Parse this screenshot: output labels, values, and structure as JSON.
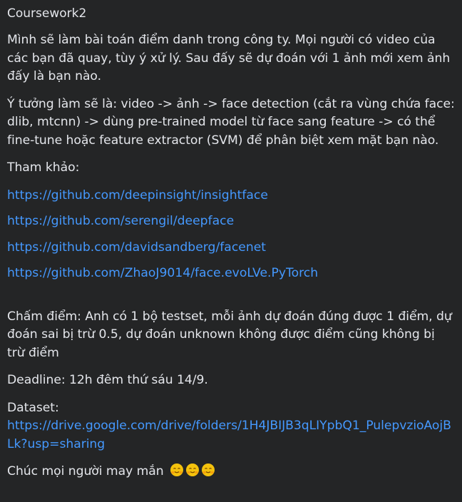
{
  "post": {
    "title": "Coursework2",
    "intro": "Mình sẽ làm bài toán điểm danh trong công ty. Mọi người có video của các bạn đã quay, tùy ý xử lý. Sau đấy sẽ dự đoán với 1 ảnh mới xem ảnh đấy là bạn nào.",
    "idea": "Ý tưởng làm sẽ là: video -> ảnh -> face detection (cắt ra vùng chứa face: dlib, mtcnn) -> dùng pre-trained model từ face sang feature -> có thể fine-tune hoặc feature extractor (SVM) để phân biệt xem mặt bạn nào.",
    "reference_label": "Tham khảo:",
    "links": [
      "https://github.com/deepinsight/insightface",
      "https://github.com/serengil/deepface",
      "https://github.com/davidsandberg/facenet",
      "https://github.com/ZhaoJ9014/face.evoLVe.PyTorch"
    ],
    "grading": "Chấm điểm: Anh có 1 bộ testset, mỗi ảnh dự đoán đúng được 1 điểm, dự đoán sai bị trừ 0.5, dự đoán unknown không được điểm cũng không bị trừ điểm",
    "deadline": "Deadline: 12h đêm thứ sáu 14/9.",
    "dataset_label": "Dataset:",
    "dataset_link": "https://drive.google.com/drive/folders/1H4JBIJB3qLIYpbQ1_PulepvzioAojBLk?usp=sharing",
    "closing": "Chúc mọi người may mắn",
    "emoji_icon": "hugging-face-emoji-icon",
    "emoji_count": 3
  }
}
